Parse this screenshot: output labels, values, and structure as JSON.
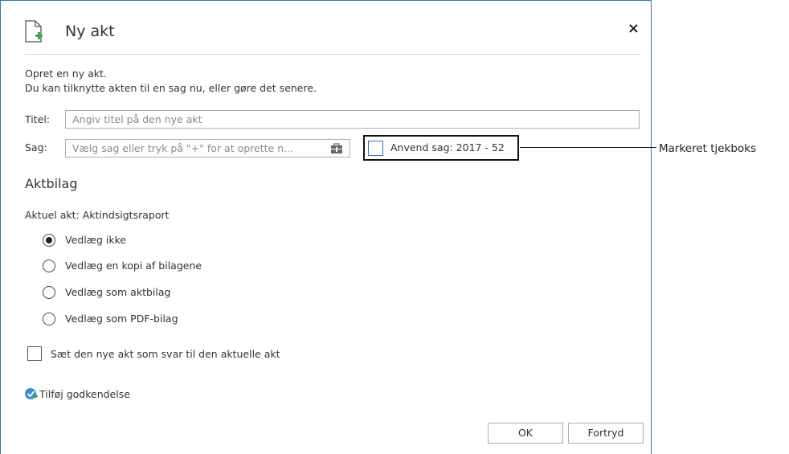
{
  "dialog": {
    "title": "Ny akt",
    "close_symbol": "×",
    "intro_line1": "Opret en ny akt.",
    "intro_line2": "Du kan tilknytte akten til en sag nu, eller gøre det senere.",
    "title_label": "Titel:",
    "title_placeholder": "Angiv titel på den nye akt",
    "case_label": "Sag:",
    "case_placeholder": "Vælg sag eller tryk på \"+\" for at oprette n...",
    "apply_case_label": "Anvend sag: 2017 - 52",
    "apply_case_checked": false
  },
  "attachments": {
    "heading": "Aktbilag",
    "current_act": "Aktuel akt: Aktindsigtsraport",
    "options": [
      {
        "label": "Vedlæg ikke",
        "selected": true
      },
      {
        "label": "Vedlæg en kopi af bilagene",
        "selected": false
      },
      {
        "label": "Vedlæg som aktbilag",
        "selected": false
      },
      {
        "label": "Vedlæg som PDF-bilag",
        "selected": false
      }
    ]
  },
  "reply_checkbox": {
    "label": "Sæt den nye akt som svar til den aktuelle akt",
    "checked": false
  },
  "approval_link": "Tilføj godkendelse",
  "buttons": {
    "ok": "OK",
    "cancel": "Fortryd"
  },
  "callout": "Markeret tjekboks",
  "colors": {
    "accent": "#2e75b6",
    "icon_green": "#3aa655",
    "approval_icon": "#3b8ec9"
  },
  "icons": {
    "header": "new-document-icon",
    "case_picker": "case-picker-icon",
    "approval": "approval-check-icon",
    "close": "close-icon"
  }
}
